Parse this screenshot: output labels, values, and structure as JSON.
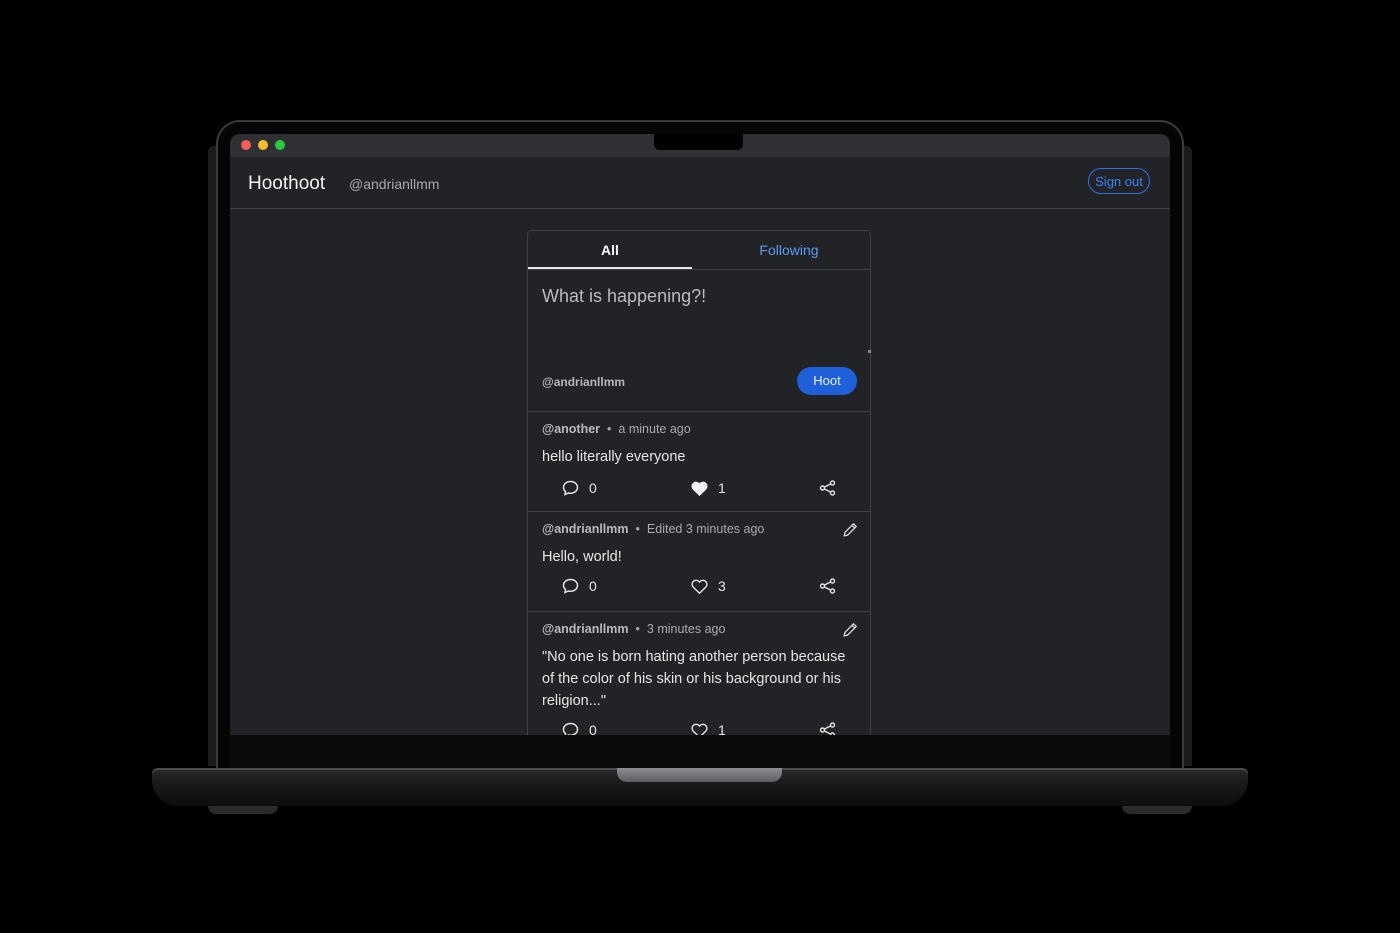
{
  "window": {
    "traffic_lights": [
      "close",
      "minimize",
      "zoom"
    ]
  },
  "navbar": {
    "brand": "Hoothoot",
    "username": "@andrianllmm",
    "signout_label": "Sign out"
  },
  "tabs": [
    {
      "label": "All",
      "active": true
    },
    {
      "label": "Following",
      "active": false
    }
  ],
  "composer": {
    "placeholder": "What is happening?!",
    "user": "@andrianllmm",
    "submit_label": "Hoot"
  },
  "posts": [
    {
      "user": "@another",
      "time": "a minute ago",
      "text": "hello literally everyone",
      "comments": "0",
      "likes": "1",
      "liked": true,
      "editable": false
    },
    {
      "user": "@andrianllmm",
      "time": "Edited 3 minutes ago",
      "text": "Hello, world!",
      "comments": "0",
      "likes": "3",
      "liked": false,
      "editable": true
    },
    {
      "user": "@andrianllmm",
      "time": "3 minutes ago",
      "text": "\"No one is born hating another person because of the color of his skin or his background or his religion...\"",
      "comments": "0",
      "likes": "1",
      "liked": false,
      "editable": true
    }
  ],
  "colors": {
    "accent": "#1f5fd8",
    "link": "#3b82f6",
    "background": "#212326"
  }
}
